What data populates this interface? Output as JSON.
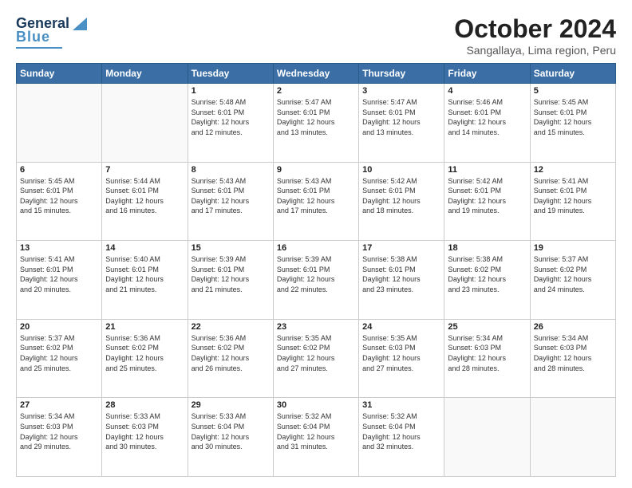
{
  "logo": {
    "line1": "General",
    "line2": "Blue"
  },
  "title": "October 2024",
  "subtitle": "Sangallaya, Lima region, Peru",
  "days_of_week": [
    "Sunday",
    "Monday",
    "Tuesday",
    "Wednesday",
    "Thursday",
    "Friday",
    "Saturday"
  ],
  "weeks": [
    [
      {
        "day": "",
        "info": ""
      },
      {
        "day": "",
        "info": ""
      },
      {
        "day": "1",
        "info": "Sunrise: 5:48 AM\nSunset: 6:01 PM\nDaylight: 12 hours\nand 12 minutes."
      },
      {
        "day": "2",
        "info": "Sunrise: 5:47 AM\nSunset: 6:01 PM\nDaylight: 12 hours\nand 13 minutes."
      },
      {
        "day": "3",
        "info": "Sunrise: 5:47 AM\nSunset: 6:01 PM\nDaylight: 12 hours\nand 13 minutes."
      },
      {
        "day": "4",
        "info": "Sunrise: 5:46 AM\nSunset: 6:01 PM\nDaylight: 12 hours\nand 14 minutes."
      },
      {
        "day": "5",
        "info": "Sunrise: 5:45 AM\nSunset: 6:01 PM\nDaylight: 12 hours\nand 15 minutes."
      }
    ],
    [
      {
        "day": "6",
        "info": "Sunrise: 5:45 AM\nSunset: 6:01 PM\nDaylight: 12 hours\nand 15 minutes."
      },
      {
        "day": "7",
        "info": "Sunrise: 5:44 AM\nSunset: 6:01 PM\nDaylight: 12 hours\nand 16 minutes."
      },
      {
        "day": "8",
        "info": "Sunrise: 5:43 AM\nSunset: 6:01 PM\nDaylight: 12 hours\nand 17 minutes."
      },
      {
        "day": "9",
        "info": "Sunrise: 5:43 AM\nSunset: 6:01 PM\nDaylight: 12 hours\nand 17 minutes."
      },
      {
        "day": "10",
        "info": "Sunrise: 5:42 AM\nSunset: 6:01 PM\nDaylight: 12 hours\nand 18 minutes."
      },
      {
        "day": "11",
        "info": "Sunrise: 5:42 AM\nSunset: 6:01 PM\nDaylight: 12 hours\nand 19 minutes."
      },
      {
        "day": "12",
        "info": "Sunrise: 5:41 AM\nSunset: 6:01 PM\nDaylight: 12 hours\nand 19 minutes."
      }
    ],
    [
      {
        "day": "13",
        "info": "Sunrise: 5:41 AM\nSunset: 6:01 PM\nDaylight: 12 hours\nand 20 minutes."
      },
      {
        "day": "14",
        "info": "Sunrise: 5:40 AM\nSunset: 6:01 PM\nDaylight: 12 hours\nand 21 minutes."
      },
      {
        "day": "15",
        "info": "Sunrise: 5:39 AM\nSunset: 6:01 PM\nDaylight: 12 hours\nand 21 minutes."
      },
      {
        "day": "16",
        "info": "Sunrise: 5:39 AM\nSunset: 6:01 PM\nDaylight: 12 hours\nand 22 minutes."
      },
      {
        "day": "17",
        "info": "Sunrise: 5:38 AM\nSunset: 6:01 PM\nDaylight: 12 hours\nand 23 minutes."
      },
      {
        "day": "18",
        "info": "Sunrise: 5:38 AM\nSunset: 6:02 PM\nDaylight: 12 hours\nand 23 minutes."
      },
      {
        "day": "19",
        "info": "Sunrise: 5:37 AM\nSunset: 6:02 PM\nDaylight: 12 hours\nand 24 minutes."
      }
    ],
    [
      {
        "day": "20",
        "info": "Sunrise: 5:37 AM\nSunset: 6:02 PM\nDaylight: 12 hours\nand 25 minutes."
      },
      {
        "day": "21",
        "info": "Sunrise: 5:36 AM\nSunset: 6:02 PM\nDaylight: 12 hours\nand 25 minutes."
      },
      {
        "day": "22",
        "info": "Sunrise: 5:36 AM\nSunset: 6:02 PM\nDaylight: 12 hours\nand 26 minutes."
      },
      {
        "day": "23",
        "info": "Sunrise: 5:35 AM\nSunset: 6:02 PM\nDaylight: 12 hours\nand 27 minutes."
      },
      {
        "day": "24",
        "info": "Sunrise: 5:35 AM\nSunset: 6:03 PM\nDaylight: 12 hours\nand 27 minutes."
      },
      {
        "day": "25",
        "info": "Sunrise: 5:34 AM\nSunset: 6:03 PM\nDaylight: 12 hours\nand 28 minutes."
      },
      {
        "day": "26",
        "info": "Sunrise: 5:34 AM\nSunset: 6:03 PM\nDaylight: 12 hours\nand 28 minutes."
      }
    ],
    [
      {
        "day": "27",
        "info": "Sunrise: 5:34 AM\nSunset: 6:03 PM\nDaylight: 12 hours\nand 29 minutes."
      },
      {
        "day": "28",
        "info": "Sunrise: 5:33 AM\nSunset: 6:03 PM\nDaylight: 12 hours\nand 30 minutes."
      },
      {
        "day": "29",
        "info": "Sunrise: 5:33 AM\nSunset: 6:04 PM\nDaylight: 12 hours\nand 30 minutes."
      },
      {
        "day": "30",
        "info": "Sunrise: 5:32 AM\nSunset: 6:04 PM\nDaylight: 12 hours\nand 31 minutes."
      },
      {
        "day": "31",
        "info": "Sunrise: 5:32 AM\nSunset: 6:04 PM\nDaylight: 12 hours\nand 32 minutes."
      },
      {
        "day": "",
        "info": ""
      },
      {
        "day": "",
        "info": ""
      }
    ]
  ]
}
